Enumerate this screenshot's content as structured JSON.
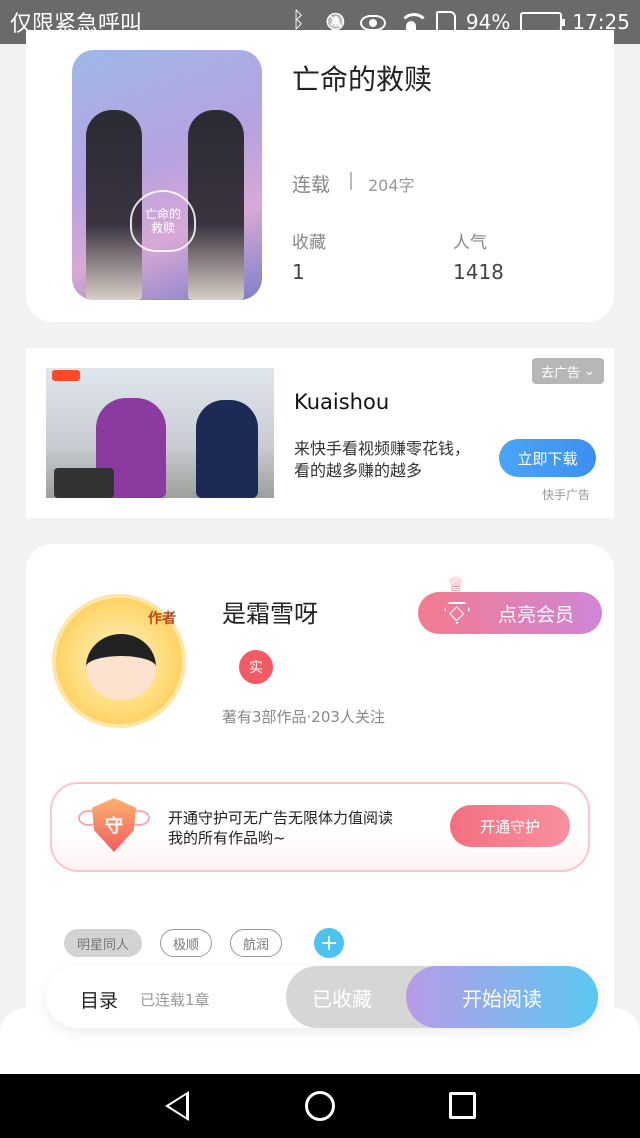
{
  "status_bar": {
    "carrier": "仅限紧急呼叫",
    "battery_pct": "94%",
    "time": "17:25",
    "battery_color": "#4cd964"
  },
  "book": {
    "title": "亡命的救赎",
    "status": "连载",
    "words": "204字",
    "stats": [
      {
        "label": "收藏",
        "value": "1"
      },
      {
        "label": "人气",
        "value": "1418"
      }
    ],
    "cover_text": "亡命的\n救赎"
  },
  "ad": {
    "advertiser": "Kuaishou",
    "description": "来快手看视频赚零花钱，看的越多赚的越多",
    "remove_label": "去广告",
    "cta_label": "立即下载",
    "source": "快手广告"
  },
  "author": {
    "avatar_tag": "作者",
    "name": "是霜雪呀",
    "real_badge": "实",
    "stats": "著有3部作品·203人关注",
    "vip_label": "点亮会员",
    "guard": {
      "shield_text": "守",
      "text_line1": "开通守护可无广告无限体力值阅读",
      "text_line2": "我的所有作品哟~",
      "button": "开通守护"
    },
    "tags": [
      "明星同人",
      "极顺",
      "航润"
    ],
    "add_tag": "+"
  },
  "action_bar": {
    "toc_label": "目录",
    "toc_sub": "已连载1章",
    "favorited_label": "已收藏",
    "read_label": "开始阅读"
  },
  "icons": [
    "bluetooth-icon",
    "mute-icon",
    "eye-icon",
    "wifi-icon",
    "sim-icon",
    "battery-icon",
    "back-icon",
    "home-icon",
    "recent-apps-icon",
    "diamond-icon",
    "crown-icon",
    "shield-icon",
    "chevron-down-icon",
    "plus-icon"
  ]
}
